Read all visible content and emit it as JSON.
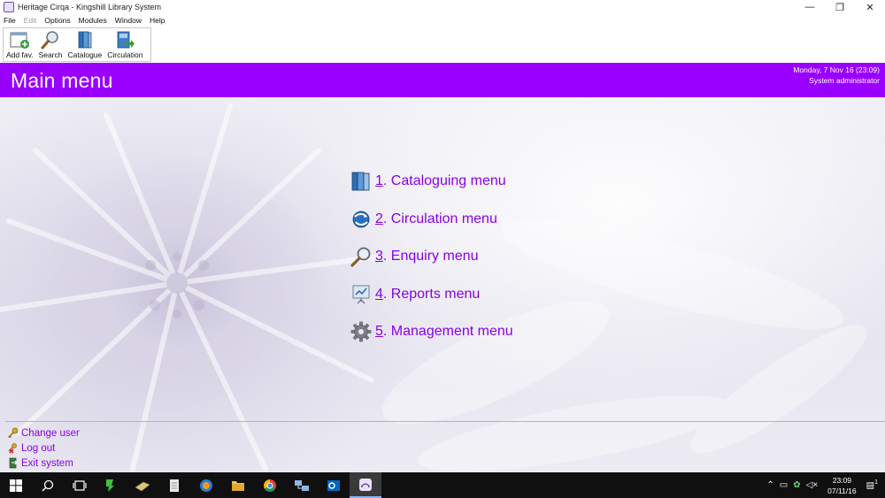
{
  "window": {
    "title": "Heritage Cirqa - Kingshill Library System",
    "controls": {
      "minimize": "—",
      "restore": "❐",
      "close": "✕"
    }
  },
  "menubar": {
    "items": [
      {
        "label": "File",
        "enabled": true
      },
      {
        "label": "Edit",
        "enabled": false
      },
      {
        "label": "Options",
        "enabled": true
      },
      {
        "label": "Modules",
        "enabled": true
      },
      {
        "label": "Window",
        "enabled": true
      },
      {
        "label": "Help",
        "enabled": true
      }
    ]
  },
  "toolbar": {
    "buttons": [
      {
        "label": "Add fav.",
        "icon": "add-favourite-icon"
      },
      {
        "label": "Search",
        "icon": "magnifier-icon"
      },
      {
        "label": "Catalogue",
        "icon": "books-icon"
      },
      {
        "label": "Circulation",
        "icon": "book-arrow-icon"
      }
    ]
  },
  "header": {
    "title": "Main menu",
    "datetime": "Monday, 7 Nov 16  (23:09)",
    "user": "System administrator",
    "color": "#9900ff"
  },
  "main_menu": {
    "items": [
      {
        "number": "1",
        "label": ". Cataloguing menu",
        "icon": "books-icon"
      },
      {
        "number": "2",
        "label": ". Circulation menu",
        "icon": "globe-arrows-icon"
      },
      {
        "number": "3",
        "label": ". Enquiry menu",
        "icon": "magnifier-icon"
      },
      {
        "number": "4",
        "label": ". Reports menu",
        "icon": "chart-easel-icon"
      },
      {
        "number": "5",
        "label": ". Management menu",
        "icon": "gear-icon"
      }
    ],
    "link_color": "#8a00e6"
  },
  "footer": {
    "links": [
      {
        "label": "Change user",
        "icon": "key-icon"
      },
      {
        "label": "Log out",
        "icon": "logout-icon"
      },
      {
        "label": "Exit system",
        "icon": "exit-door-icon"
      }
    ]
  },
  "taskbar": {
    "clock_time": "23:09",
    "clock_date": "07/11/16",
    "notification_count": "1"
  }
}
